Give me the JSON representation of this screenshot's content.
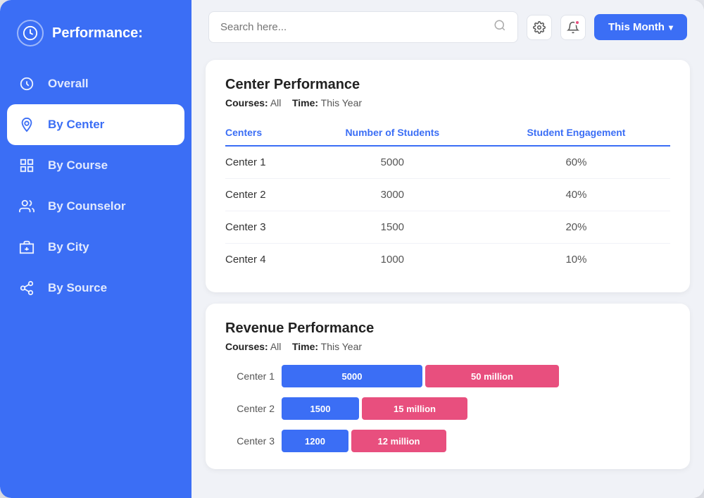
{
  "sidebar": {
    "header_icon": "◎",
    "header_title": "Performance:",
    "items": [
      {
        "id": "overall",
        "label": "Overall",
        "icon": "↺",
        "active": false
      },
      {
        "id": "by-center",
        "label": "By Center",
        "icon": "📍",
        "active": true
      },
      {
        "id": "by-course",
        "label": "By Course",
        "icon": "📖",
        "active": false
      },
      {
        "id": "by-counselor",
        "label": "By Counselor",
        "icon": "👤",
        "active": false
      },
      {
        "id": "by-city",
        "label": "By City",
        "icon": "🏢",
        "active": false
      },
      {
        "id": "by-source",
        "label": "By Source",
        "icon": "🔗",
        "active": false
      }
    ]
  },
  "topbar": {
    "search_placeholder": "Search here...",
    "month_button_label": "This Month"
  },
  "center_performance": {
    "title": "Center Performance",
    "courses_label": "Courses:",
    "courses_value": "All",
    "time_label": "Time:",
    "time_value": "This Year",
    "columns": [
      "Centers",
      "Number of Students",
      "Student Engagement"
    ],
    "rows": [
      {
        "center": "Center 1",
        "students": "5000",
        "engagement": "60%"
      },
      {
        "center": "Center 2",
        "students": "3000",
        "engagement": "40%"
      },
      {
        "center": "Center 3",
        "students": "1500",
        "engagement": "20%"
      },
      {
        "center": "Center 4",
        "students": "1000",
        "engagement": "10%"
      }
    ]
  },
  "revenue_performance": {
    "title": "Revenue Performance",
    "courses_label": "Courses:",
    "courses_value": "All",
    "time_label": "Time:",
    "time_value": "This Year",
    "bars": [
      {
        "label": "Center 1",
        "students": "5000",
        "revenue": "50 million",
        "blue_width": 200,
        "pink_width": 190
      },
      {
        "label": "Center 2",
        "students": "1500",
        "revenue": "15 million",
        "blue_width": 110,
        "pink_width": 150
      },
      {
        "label": "Center 3",
        "students": "1200",
        "revenue": "12 million",
        "blue_width": 95,
        "pink_width": 135
      }
    ]
  },
  "colors": {
    "accent": "#3b6ef5",
    "pink": "#e84f7e"
  }
}
